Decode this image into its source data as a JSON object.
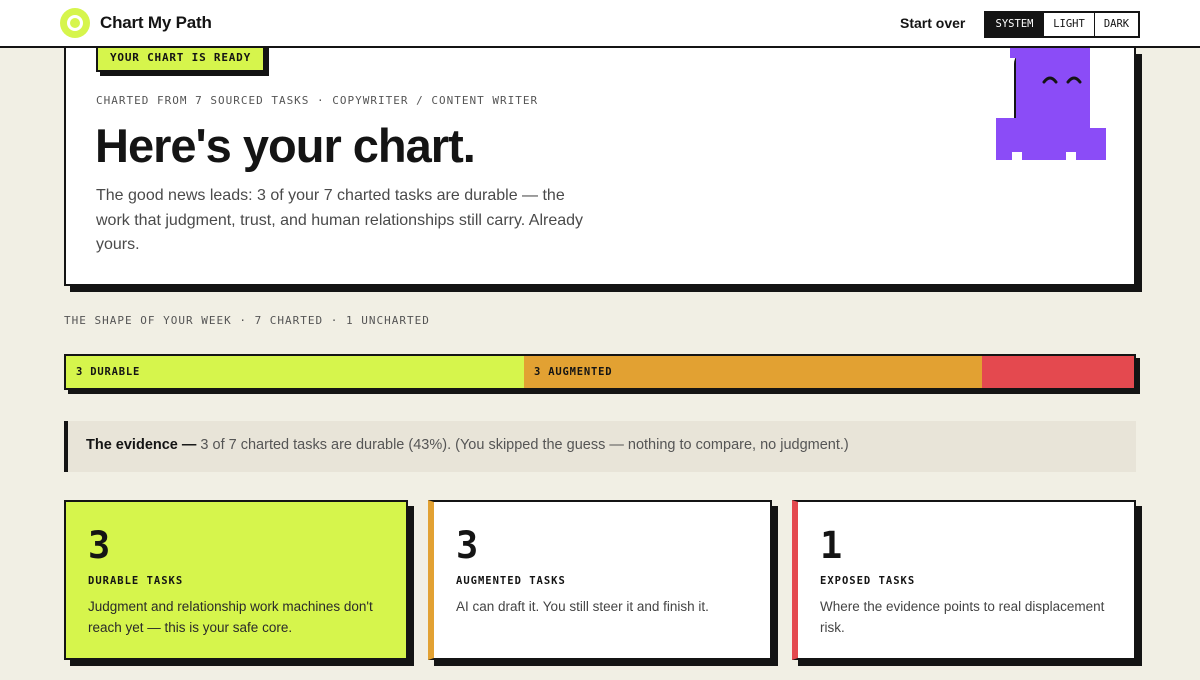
{
  "header": {
    "brand": "Chart My Path",
    "start_over": "Start over",
    "theme_options": [
      "SYSTEM",
      "LIGHT",
      "DARK"
    ],
    "theme_selected": "SYSTEM"
  },
  "hero": {
    "badge": "YOUR CHART IS READY",
    "meta": "CHARTED FROM 7 SOURCED TASKS · COPYWRITER / CONTENT WRITER",
    "headline": "Here's your chart.",
    "lede": "The good news leads: 3 of your 7 charted tasks are durable — the work that judgment, trust, and human relationships still carry. Already yours."
  },
  "week": {
    "label": "THE SHAPE OF YOUR WEEK · 7 CHARTED · 1 UNCHARTED",
    "segments": [
      {
        "label": "3 DURABLE",
        "count": 3,
        "color": "#d6f54c"
      },
      {
        "label": "3 AUGMENTED",
        "count": 3,
        "color": "#e2a132"
      },
      {
        "label": "",
        "count": 1,
        "color": "#e4494f"
      }
    ]
  },
  "evidence": {
    "lead": "The evidence —",
    "text": " 3 of 7 charted tasks are durable (43%). (You skipped the guess — nothing to compare, no judgment.)"
  },
  "cards": [
    {
      "number": "3",
      "title": "DURABLE TASKS",
      "desc": "Judgment and relationship work machines don't reach yet — this is your safe core.",
      "color": "#d6f54c"
    },
    {
      "number": "3",
      "title": "AUGMENTED TASKS",
      "desc": "AI can draft it. You still steer it and finish it.",
      "color": "#e2a132"
    },
    {
      "number": "1",
      "title": "EXPOSED TASKS",
      "desc": "Where the evidence points to real displacement risk.",
      "color": "#e4494f"
    }
  ],
  "colors": {
    "accent_lime": "#d6f54c",
    "accent_orange": "#e2a132",
    "accent_red": "#e4494f",
    "mascot_purple": "#8b4cf7",
    "ink": "#141414",
    "page_bg": "#f1efe4"
  }
}
